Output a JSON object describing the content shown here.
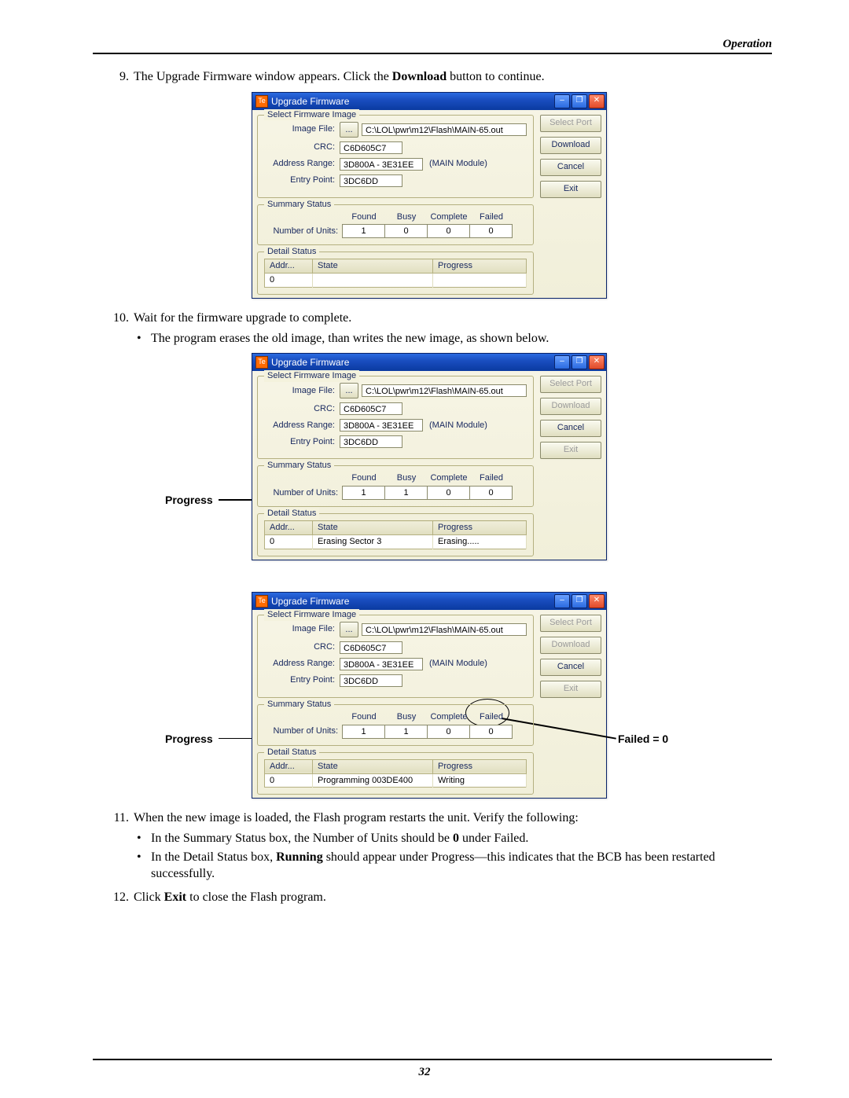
{
  "header": {
    "title": "Operation"
  },
  "page_number": "32",
  "steps": {
    "s9": {
      "num": "9.",
      "text_a": "The Upgrade Firmware window appears. Click the ",
      "text_bold": "Download",
      "text_b": " button to continue."
    },
    "s10": {
      "num": "10.",
      "text": "Wait for the firmware upgrade to complete.",
      "b1": "The program erases the old image, than writes the new image, as shown below."
    },
    "s11": {
      "num": "11.",
      "text": "When the new image is loaded, the Flash program restarts the unit. Verify the following:",
      "b1a": "In the Summary Status box, the Number of Units should be ",
      "b1bold": "0",
      "b1b": " under Failed.",
      "b2a": "In the Detail Status box, ",
      "b2bold": "Running",
      "b2b": " should appear under Progress—this indicates that the BCB has been restarted successfully."
    },
    "s12": {
      "num": "12.",
      "text_a": "Click ",
      "text_bold": "Exit",
      "text_b": " to close the Flash program."
    }
  },
  "callouts": {
    "progress": "Progress",
    "failed": "Failed = 0"
  },
  "dialog_common": {
    "title": "Upgrade Firmware",
    "select_legend": "Select Firmware Image",
    "image_file_label": "Image File:",
    "browse": "...",
    "image_file_value": "C:\\LOL\\pwr\\m12\\Flash\\MAIN-65.out",
    "crc_label": "CRC:",
    "crc_value": "C6D605C7",
    "addr_label": "Address Range:",
    "addr_value": "3D800A - 3E31EE",
    "addr_module": "(MAIN Module)",
    "entry_label": "Entry Point:",
    "entry_value": "3DC6DD",
    "summary_legend": "Summary Status",
    "h_found": "Found",
    "h_busy": "Busy",
    "h_complete": "Complete",
    "h_failed": "Failed",
    "num_units_label": "Number of Units:",
    "detail_legend": "Detail Status",
    "col_addr": "Addr...",
    "col_state": "State",
    "col_progress": "Progress",
    "btn_select_port": "Select Port",
    "btn_download": "Download",
    "btn_cancel": "Cancel",
    "btn_exit": "Exit"
  },
  "dialog1": {
    "found": "1",
    "busy": "0",
    "complete": "0",
    "failed": "0",
    "row_addr": "0",
    "row_state": "",
    "row_progress": "",
    "disabled": {
      "select_port": true,
      "download": false,
      "cancel": false,
      "exit": false
    }
  },
  "dialog2": {
    "found": "1",
    "busy": "1",
    "complete": "0",
    "failed": "0",
    "row_addr": "0",
    "row_state": "Erasing Sector 3",
    "row_progress": "Erasing.....",
    "disabled": {
      "select_port": true,
      "download": true,
      "cancel": false,
      "exit": true
    }
  },
  "dialog3": {
    "found": "1",
    "busy": "1",
    "complete": "0",
    "failed": "0",
    "row_addr": "0",
    "row_state": "Programming 003DE400",
    "row_progress": "Writing",
    "disabled": {
      "select_port": true,
      "download": true,
      "cancel": false,
      "exit": true
    }
  }
}
